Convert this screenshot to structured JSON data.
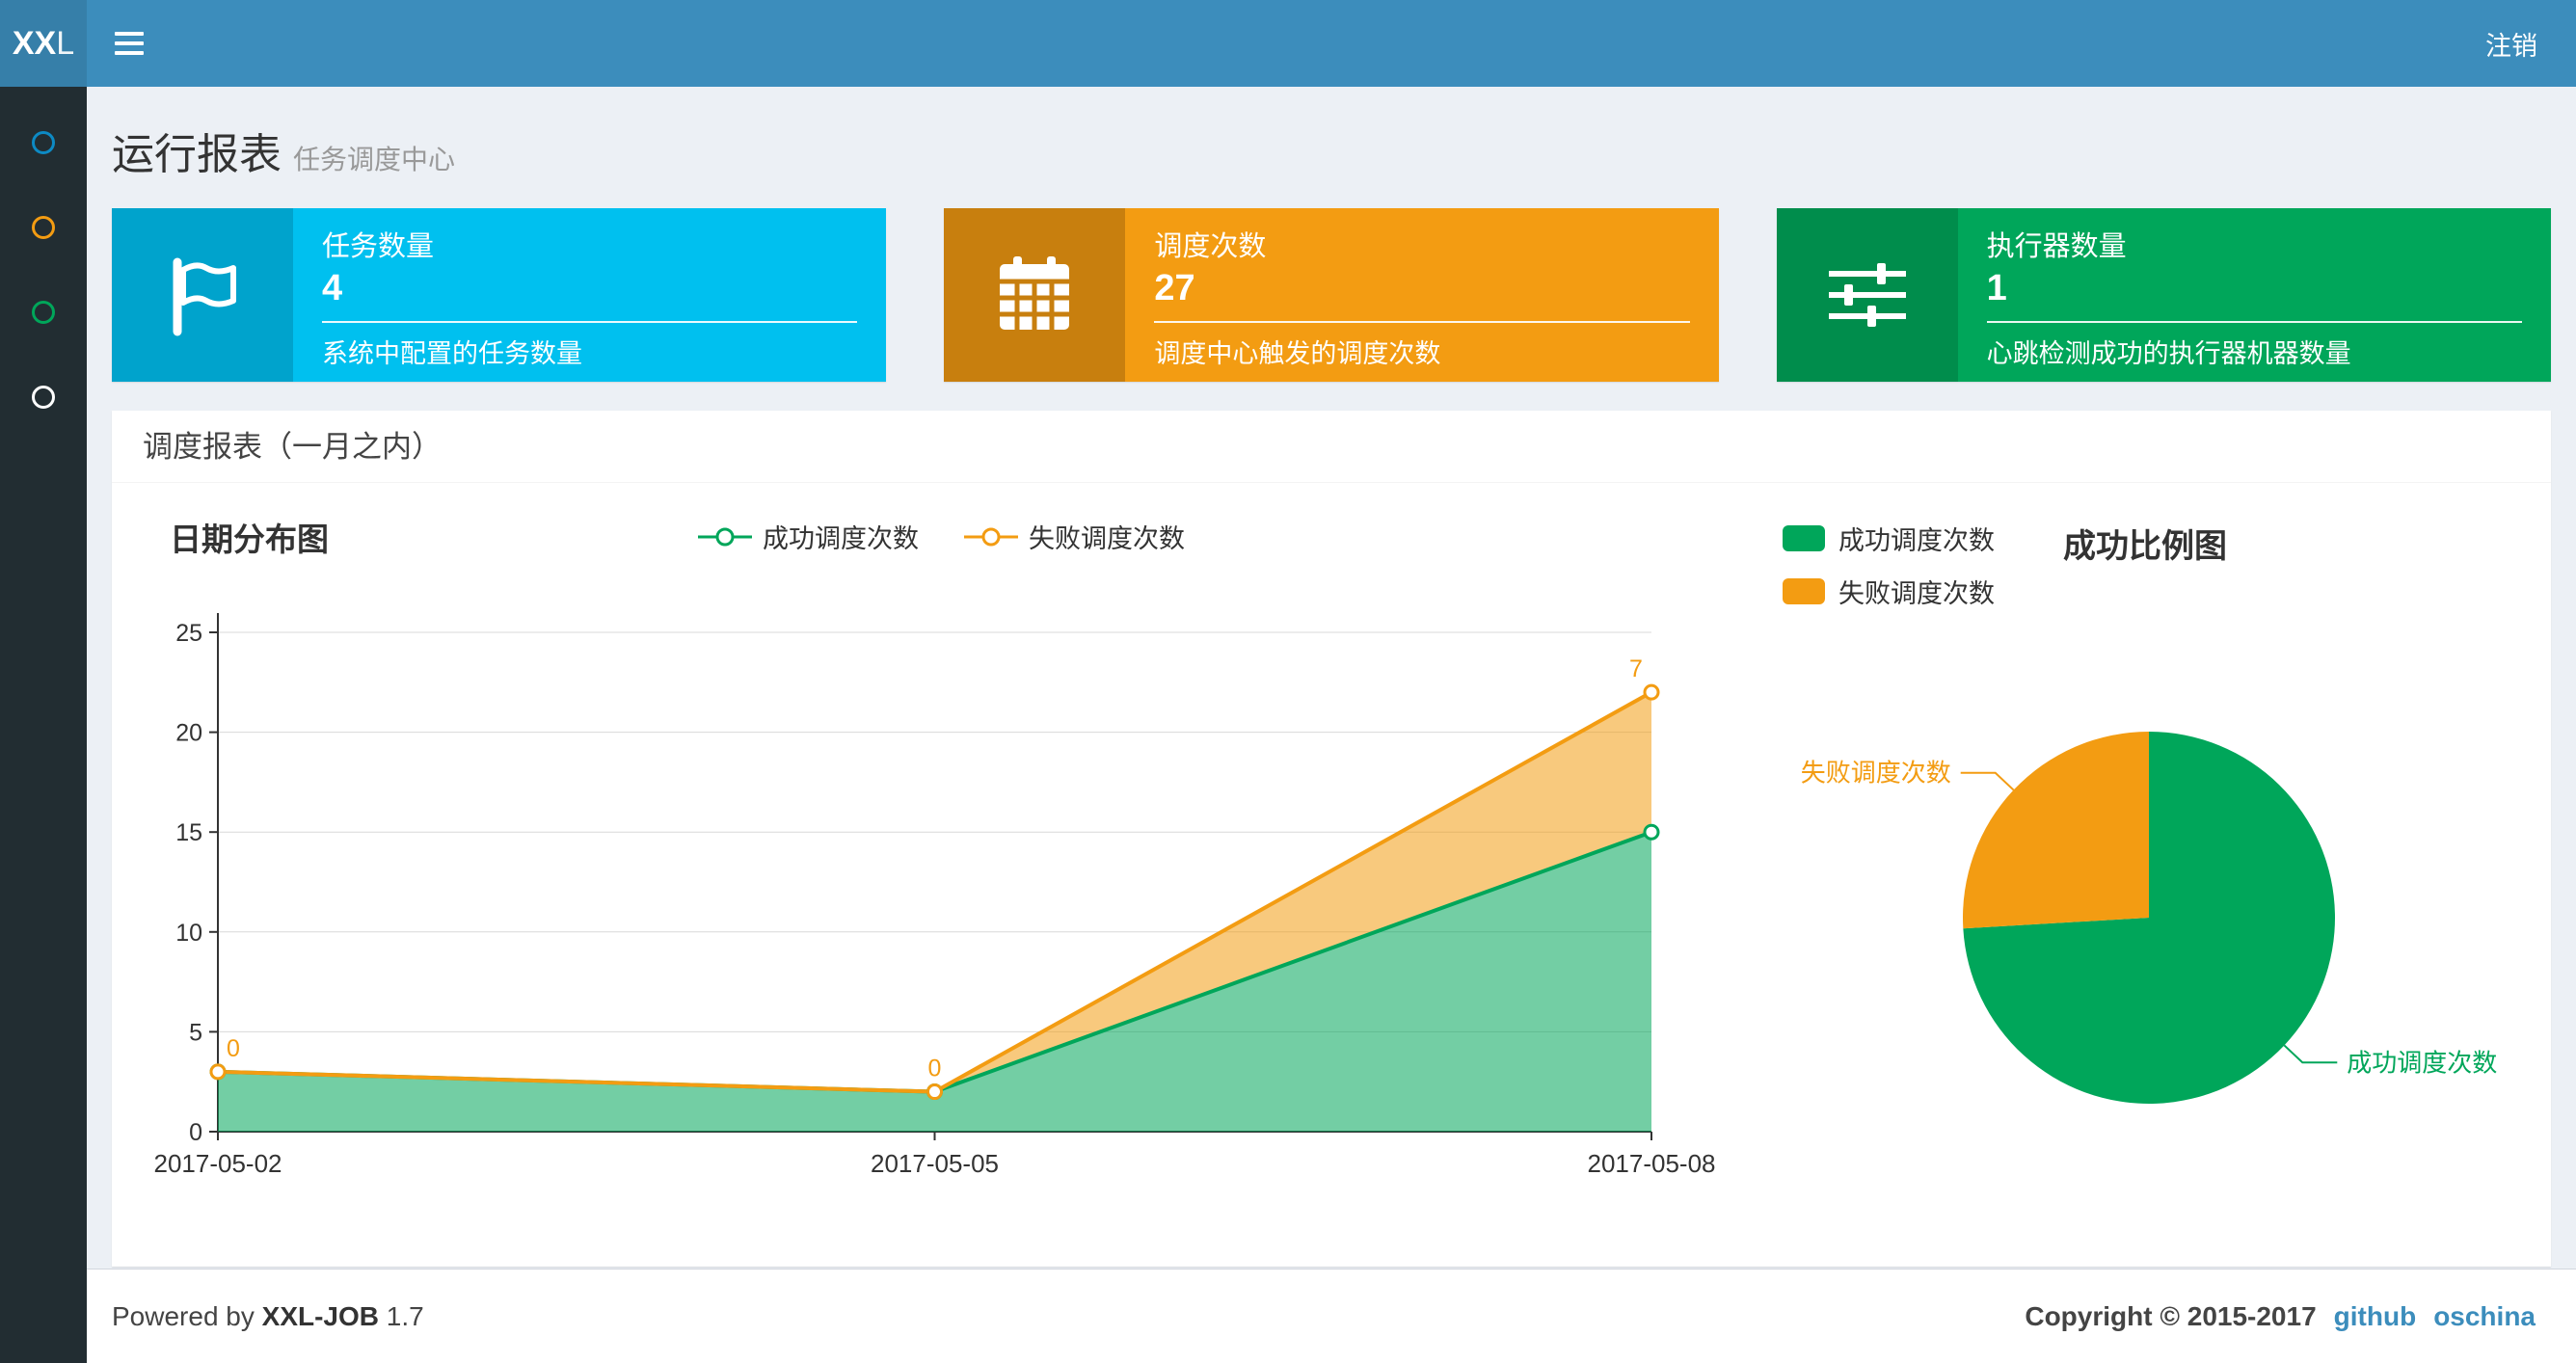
{
  "navbar": {
    "logo_bold": "XX",
    "logo_light": "L",
    "logout": "注销"
  },
  "sidebar": {
    "items": [
      {
        "color": "#0d8ac4"
      },
      {
        "color": "#f39c12"
      },
      {
        "color": "#00a65a"
      },
      {
        "color": "#ffffff"
      }
    ]
  },
  "page": {
    "title": "运行报表",
    "subtitle": "任务调度中心"
  },
  "info_boxes": [
    {
      "label": "任务数量",
      "value": "4",
      "desc": "系统中配置的任务数量",
      "color": "#00c0ef",
      "icon_bg": "#00a3cc",
      "icon": "flag-icon"
    },
    {
      "label": "调度次数",
      "value": "27",
      "desc": "调度中心触发的调度次数",
      "color": "#f39c12",
      "icon_bg": "#c87f0e",
      "icon": "calendar-icon"
    },
    {
      "label": "执行器数量",
      "value": "1",
      "desc": "心跳检测成功的执行器机器数量",
      "color": "#00a65a",
      "icon_bg": "#008d4c",
      "icon": "sliders-icon"
    }
  ],
  "panel": {
    "title": "调度报表（一月之内）"
  },
  "chart_data": [
    {
      "type": "area",
      "title": "日期分布图",
      "x": [
        "2017-05-02",
        "2017-05-05",
        "2017-05-08"
      ],
      "series": [
        {
          "name": "成功调度次数",
          "color": "#00a65a",
          "values": [
            3,
            2,
            15
          ]
        },
        {
          "name": "失败调度次数",
          "color": "#f39c12",
          "values": [
            0,
            0,
            7
          ],
          "labels": [
            "0",
            "0",
            "7"
          ]
        }
      ],
      "stacked": true,
      "grid": true,
      "legend_position": "top-center",
      "ylim": [
        0,
        25
      ],
      "yticks": [
        0,
        5,
        10,
        15,
        20,
        25
      ],
      "xlabel": "",
      "ylabel": ""
    },
    {
      "type": "pie",
      "title": "成功比例图",
      "legend_position": "top-left",
      "slices": [
        {
          "name": "成功调度次数",
          "value": 20,
          "color": "#00a65a"
        },
        {
          "name": "失败调度次数",
          "value": 7,
          "color": "#f39c12"
        }
      ]
    }
  ],
  "footer": {
    "powered": "Powered by",
    "brand": "XXL-JOB",
    "version": "1.7",
    "copyright": "Copyright © 2015-2017",
    "links": [
      "github",
      "oschina"
    ]
  }
}
